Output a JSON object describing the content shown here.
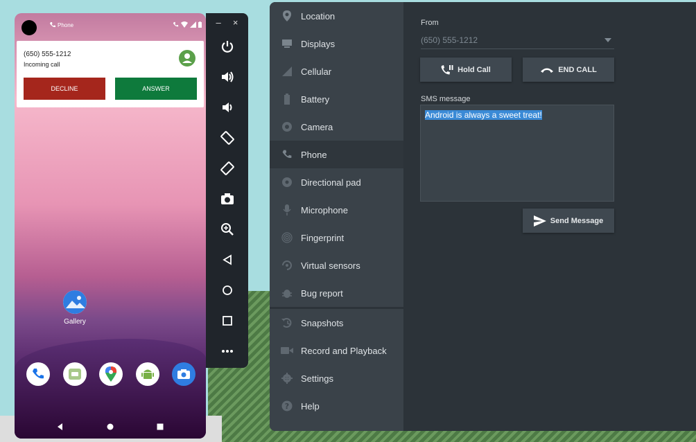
{
  "phone": {
    "status_app": "Phone",
    "notification": {
      "number": "(650) 555-1212",
      "subtitle": "Incoming call",
      "decline_label": "DECLINE",
      "answer_label": "ANSWER"
    },
    "home": {
      "gallery_label": "Gallery",
      "dock_apps": [
        "phone-app-icon",
        "messages-app-icon",
        "maps-app-icon",
        "android-app-icon",
        "camera-app-icon"
      ]
    }
  },
  "toolbar": {
    "minimize": "–",
    "close": "×",
    "buttons": [
      "power-icon",
      "volume-up-icon",
      "volume-down-icon",
      "rotate-left-icon",
      "rotate-right-icon",
      "screenshot-icon",
      "zoom-icon",
      "back-icon",
      "home-icon",
      "overview-icon",
      "more-icon"
    ]
  },
  "extended": {
    "sidebar": {
      "items": [
        {
          "label": "Location",
          "icon": "location-icon"
        },
        {
          "label": "Displays",
          "icon": "displays-icon"
        },
        {
          "label": "Cellular",
          "icon": "cellular-icon"
        },
        {
          "label": "Battery",
          "icon": "battery-icon"
        },
        {
          "label": "Camera",
          "icon": "camera-icon"
        },
        {
          "label": "Phone",
          "icon": "phone-icon"
        },
        {
          "label": "Directional pad",
          "icon": "dpad-icon"
        },
        {
          "label": "Microphone",
          "icon": "microphone-icon"
        },
        {
          "label": "Fingerprint",
          "icon": "fingerprint-icon"
        },
        {
          "label": "Virtual sensors",
          "icon": "sensors-icon"
        },
        {
          "label": "Bug report",
          "icon": "bug-icon"
        }
      ],
      "items2": [
        {
          "label": "Snapshots",
          "icon": "snapshots-icon"
        },
        {
          "label": "Record and Playback",
          "icon": "record-icon"
        },
        {
          "label": "Settings",
          "icon": "settings-icon"
        },
        {
          "label": "Help",
          "icon": "help-icon"
        }
      ],
      "active": "Phone"
    },
    "phone": {
      "from_label": "From",
      "from_value": "(650) 555-1212",
      "hold_label": "Hold Call",
      "end_label": "END CALL",
      "sms_label": "SMS message",
      "sms_text": "Android is always a sweet treat!",
      "send_label": "Send Message"
    }
  },
  "colors": {
    "decline": "#a5261c",
    "answer": "#0e7a3c",
    "panel": "#2c3339",
    "sidebar": "#3a4249",
    "selection": "#3a8ad6"
  }
}
